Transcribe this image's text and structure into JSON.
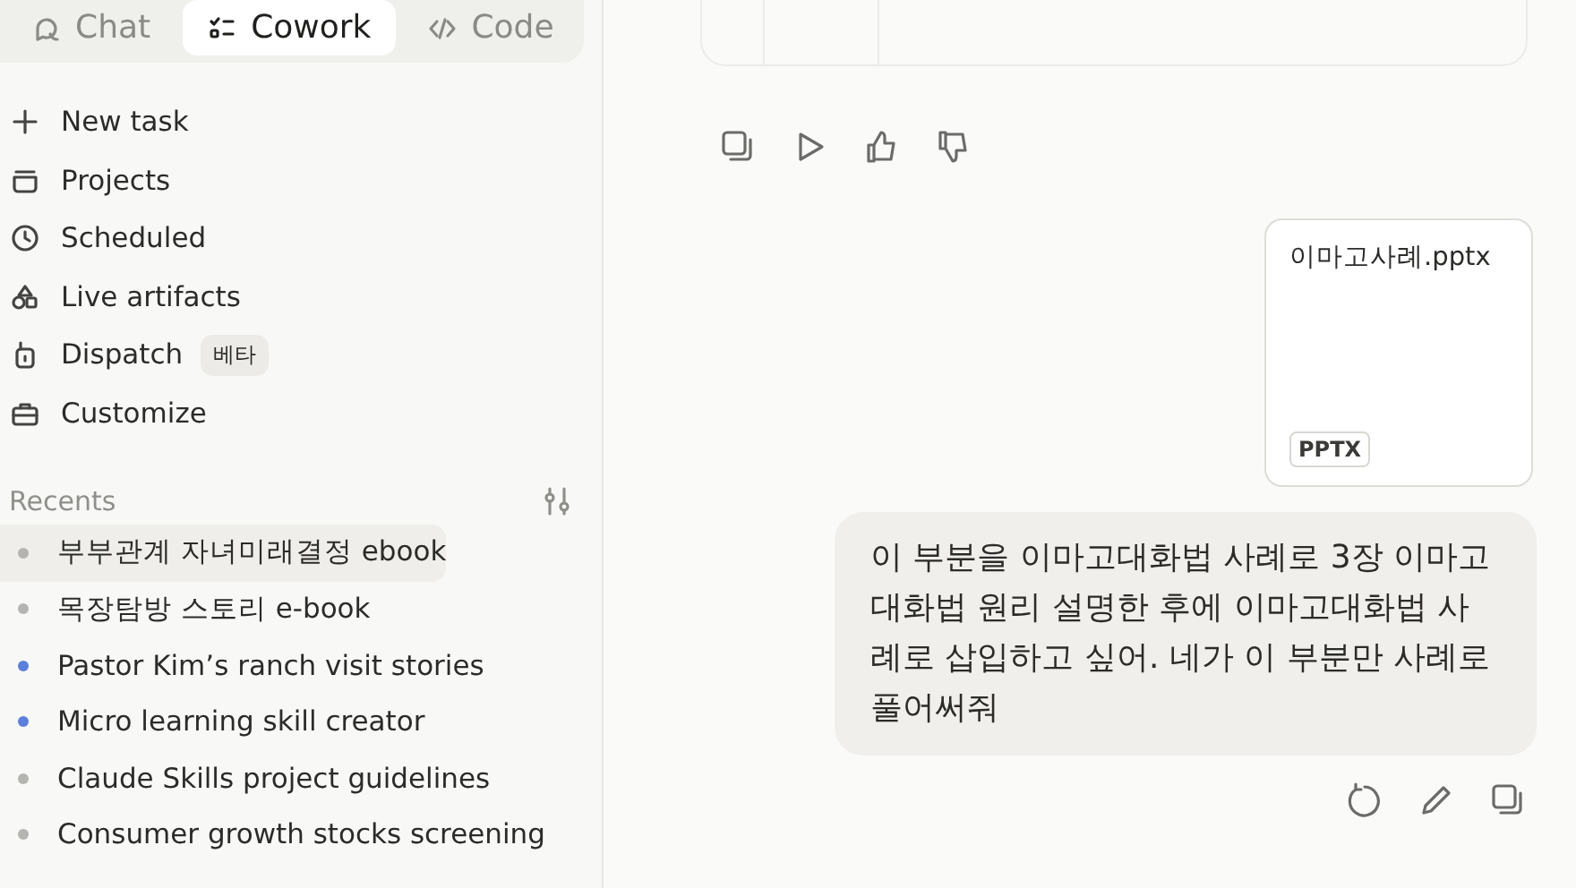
{
  "tabs": [
    {
      "label": "Chat",
      "selected": false
    },
    {
      "label": "Cowork",
      "selected": true
    },
    {
      "label": "Code",
      "selected": false
    }
  ],
  "nav": [
    {
      "label": "New task"
    },
    {
      "label": "Projects"
    },
    {
      "label": "Scheduled"
    },
    {
      "label": "Live artifacts"
    },
    {
      "label": "Dispatch",
      "badge": "베타"
    },
    {
      "label": "Customize"
    }
  ],
  "recents": {
    "title": "Recents",
    "items": [
      {
        "title": "부부관계 자녀미래결정 ebook",
        "selected": true,
        "color": "#b4b4b0"
      },
      {
        "title": "목장탐방 스토리 e-book",
        "selected": false,
        "color": "#b4b4b0"
      },
      {
        "title": "Pastor Kim’s ranch visit stories",
        "selected": false,
        "color": "#5a7fdc"
      },
      {
        "title": "Micro learning skill creator",
        "selected": false,
        "color": "#5a7fdc"
      },
      {
        "title": "Claude Skills project guidelines",
        "selected": false,
        "color": "#b4b4b0"
      },
      {
        "title": "Consumer growth stocks screening",
        "selected": false,
        "color": "#b4b4b0"
      }
    ]
  },
  "chat": {
    "attachment": {
      "name": "이마고사례.pptx",
      "type": "PPTX"
    },
    "message": "이 부분을 이마고대화법 사례로 3장 이마고 대화법 원리 설명한 후에 이마고대화법 사례로 삽입하고 싶어. 네가 이 부분만 사례로 풀어써줘"
  }
}
